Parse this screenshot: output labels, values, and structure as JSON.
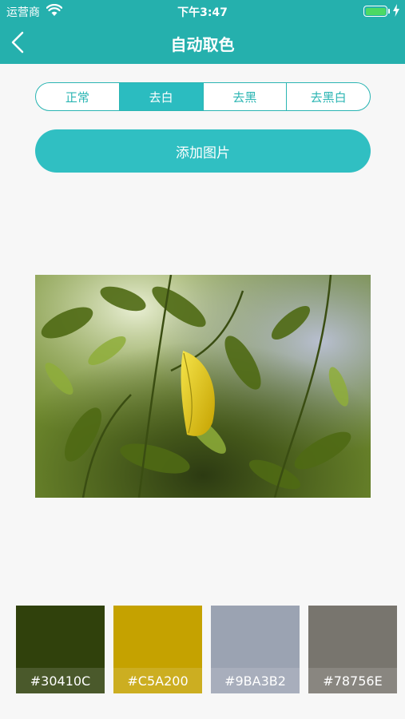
{
  "status_bar": {
    "carrier": "运营商",
    "time": "下午3:47"
  },
  "nav": {
    "title": "自动取色",
    "back_icon": "chevron-left-icon"
  },
  "segments": [
    {
      "label": "正常",
      "selected": false
    },
    {
      "label": "去白",
      "selected": true
    },
    {
      "label": "去黑",
      "selected": false
    },
    {
      "label": "去黑白",
      "selected": false
    }
  ],
  "add_button": {
    "label": "添加图片"
  },
  "photo": {
    "description_icon": "leaf-photo"
  },
  "palette": [
    {
      "hex": "#30410C"
    },
    {
      "hex": "#C5A200"
    },
    {
      "hex": "#9BA3B2"
    },
    {
      "hex": "#78756E"
    }
  ],
  "colors": {
    "accent": "#25b0ad",
    "button": "#30bfc2",
    "background": "#f7f7f7"
  }
}
